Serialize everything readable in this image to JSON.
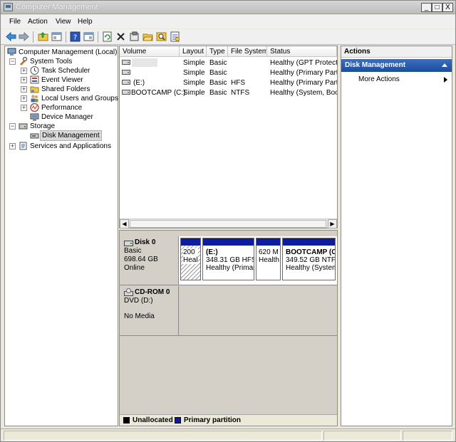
{
  "window": {
    "title": "Computer Management"
  },
  "window_controls": {
    "minimize": "_",
    "maximize": "□",
    "close": "X"
  },
  "menu": {
    "file": "File",
    "action": "Action",
    "view": "View",
    "help": "Help"
  },
  "toolbar_icons": [
    "back-arrow-icon",
    "forward-arrow-icon",
    "up-folder-icon",
    "show-hide-tree-icon",
    "help-icon",
    "properties-icon",
    "refresh-icon",
    "delete-icon",
    "settings-icon",
    "open-icon",
    "search-icon",
    "export-icon"
  ],
  "tree": {
    "root": "Computer Management (Local)",
    "system_tools": "System Tools",
    "task_scheduler": "Task Scheduler",
    "event_viewer": "Event Viewer",
    "shared_folders": "Shared Folders",
    "local_users": "Local Users and Groups",
    "performance": "Performance",
    "device_manager": "Device Manager",
    "storage": "Storage",
    "disk_management": "Disk Management",
    "services": "Services and Applications",
    "expand": "+",
    "collapse": "−"
  },
  "volumes": {
    "headers": {
      "volume": "Volume",
      "layout": "Layout",
      "type": "Type",
      "file_system": "File System",
      "status": "Status"
    },
    "rows": [
      {
        "volume": "",
        "layout": "Simple",
        "type": "Basic",
        "fs": "",
        "status": "Healthy (GPT Protective"
      },
      {
        "volume": "",
        "layout": "Simple",
        "type": "Basic",
        "fs": "",
        "status": "Healthy (Primary Partiti"
      },
      {
        "volume": "(E:)",
        "layout": "Simple",
        "type": "Basic",
        "fs": "HFS",
        "status": "Healthy (Primary Partiti"
      },
      {
        "volume": "BOOTCAMP (C:)",
        "layout": "Simple",
        "type": "Basic",
        "fs": "NTFS",
        "status": "Healthy (System, Boot,"
      }
    ]
  },
  "scrollbar": {
    "left": "◀",
    "right": "▶"
  },
  "disks": {
    "disk0": {
      "name": "Disk 0",
      "type": "Basic",
      "size": "698.64 GB",
      "state": "Online"
    },
    "cdrom0": {
      "name": "CD-ROM 0",
      "drive": "DVD (D:)",
      "media": "No Media"
    },
    "partitions": [
      {
        "title": "",
        "line1": "200",
        "line2": "Heal"
      },
      {
        "title": "(E:)",
        "line1": "348.31 GB HFS",
        "line2": "Healthy (Primar"
      },
      {
        "title": "",
        "line1": "620 M",
        "line2": "Health"
      },
      {
        "title": "BOOTCAMP  (C",
        "line1": "349.52 GB NTFS",
        "line2": "Healthy (System"
      }
    ]
  },
  "legend": {
    "unallocated": "Unallocated",
    "primary": "Primary partition",
    "unallocated_color": "#000000",
    "primary_color": "#0f1c9c"
  },
  "actions": {
    "header": "Actions",
    "section": "Disk Management",
    "more": "More Actions"
  }
}
